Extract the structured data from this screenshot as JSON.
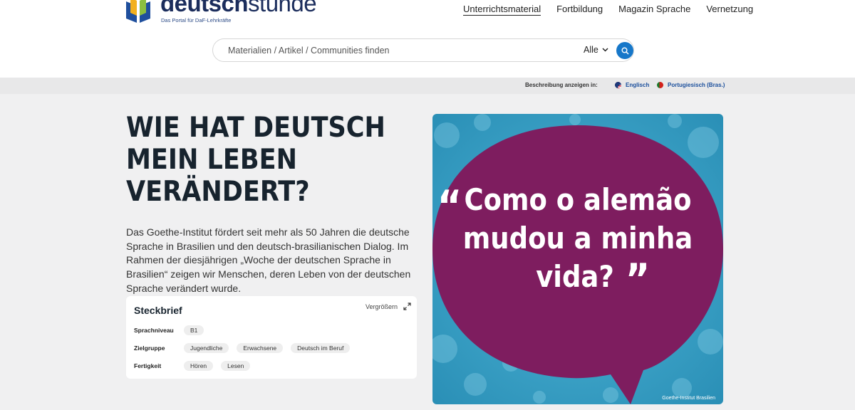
{
  "header": {
    "logo": {
      "word_bold": "deutsch",
      "word_light": "stunde",
      "tagline": "Das Portal für DaF-Lehrkräfte"
    },
    "nav": [
      {
        "label": "Unterrichtsmaterial",
        "active": true
      },
      {
        "label": "Fortbildung",
        "active": false
      },
      {
        "label": "Magazin Sprache",
        "active": false
      },
      {
        "label": "Vernetzung",
        "active": false
      }
    ],
    "search": {
      "placeholder": "Materialien / Artikel / Communities finden",
      "filter_label": "Alle",
      "button_icon": "search-icon"
    }
  },
  "language_bar": {
    "label": "Beschreibung anzeigen in:",
    "options": [
      {
        "label": "Englisch",
        "flag": "us-flag-icon"
      },
      {
        "label": "Portugiesisch (Bras.)",
        "flag": "portugal-flag-icon"
      }
    ]
  },
  "article": {
    "title": "WIE HAT DEUTSCH MEIN LEBEN VERÄNDERT?",
    "lead": "Das Goethe-Institut fördert seit mehr als 50 Jahren die deutsche Sprache in Brasilien und den deutsch-brasilianischen Dialog. Im Rahmen der diesjährigen „Woche der deutschen Sprache in Brasilien“ zeigen wir Menschen, deren Leben von der deutschen Sprache verändert wurde."
  },
  "profile": {
    "title": "Steckbrief",
    "enlarge_label": "Vergrößern",
    "rows": [
      {
        "label": "Sprachniveau",
        "tags": [
          "B1"
        ]
      },
      {
        "label": "Zielgruppe",
        "tags": [
          "Jugendliche",
          "Erwachsene",
          "Deutsch im Beruf"
        ]
      },
      {
        "label": "Fertigkeit",
        "tags": [
          "Hören",
          "Lesen"
        ]
      }
    ]
  },
  "hero_image": {
    "open_quote": "“",
    "close_quote": "”",
    "lines": [
      "Como o alemão",
      "mudou a minha",
      "vida?"
    ],
    "credit": "Goethe-Institut Brasilien",
    "colors": {
      "background": "#3aa3c8",
      "bubble": "#7e1d5f"
    }
  },
  "colors": {
    "accent": "#1677c9",
    "page_bg": "#f0f0f1",
    "link": "#1b4f9c"
  }
}
